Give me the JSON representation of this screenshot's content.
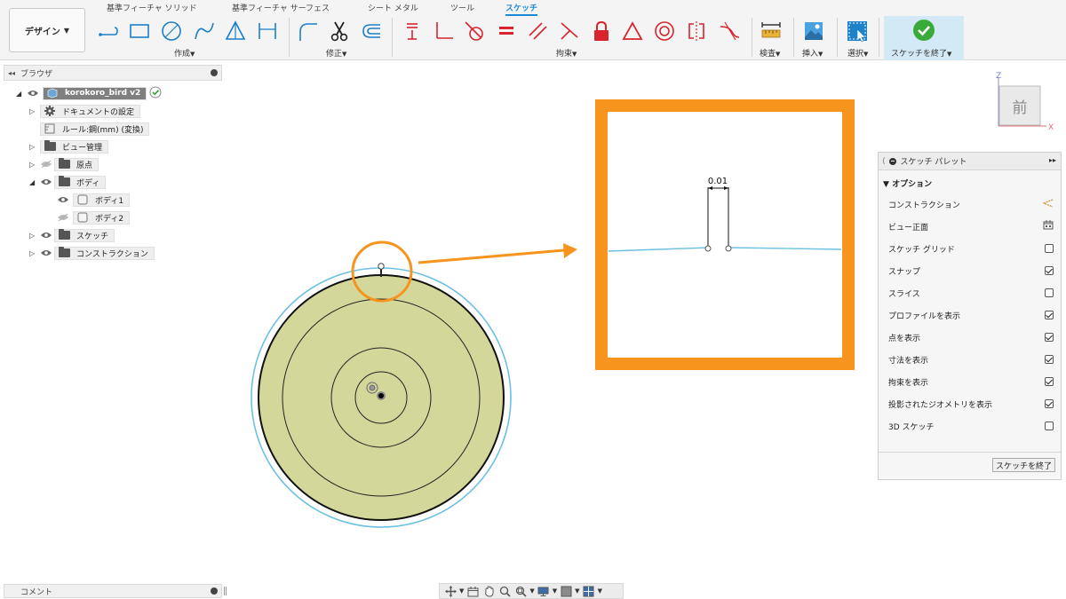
{
  "toolbar": {
    "workspace_button": "デザイン",
    "tabs": [
      {
        "label": "基準フィーチャ ソリッド",
        "active": false
      },
      {
        "label": "基準フィーチャ サーフェス",
        "active": false
      },
      {
        "label": "シート メタル",
        "active": false
      },
      {
        "label": "ツール",
        "active": false
      },
      {
        "label": "スケッチ",
        "active": true
      }
    ],
    "groups": {
      "create": "作成",
      "modify": "修正",
      "constraints": "拘束",
      "inspect": "検査",
      "insert": "挿入",
      "select": "選択",
      "finish_sketch": "スケッチを終了"
    },
    "accent_color": "#1a8ad8",
    "constraint_color": "#d8242c"
  },
  "browser": {
    "title": "ブラウザ",
    "items": [
      {
        "label": "korokoro_bird v2",
        "icon": "component-icon"
      },
      {
        "label": "ドキュメントの設定",
        "icon": "gear-icon"
      },
      {
        "label": "ルール:鋼(mm) (変換)",
        "icon": "ruler-icon"
      },
      {
        "label": "ビュー管理",
        "icon": "folder-icon"
      },
      {
        "label": "原点",
        "icon": "folder-icon"
      },
      {
        "label": "ボディ",
        "icon": "folder-icon"
      },
      {
        "label": "ボディ1",
        "icon": "body-icon"
      },
      {
        "label": "ボディ2",
        "icon": "body-icon"
      },
      {
        "label": "スケッチ",
        "icon": "folder-icon"
      },
      {
        "label": "コンストラクション",
        "icon": "folder-icon"
      }
    ]
  },
  "canvas": {
    "dimension_label": "0.01",
    "sketch_color": "#6cc0e0",
    "body_fill": "#d4d79a",
    "callout_color": "#f7941d"
  },
  "viewcube": {
    "face_label": "前",
    "axis_z": "Z",
    "axis_x": "X"
  },
  "palette": {
    "title": "スケッチ パレット",
    "section": "オプション",
    "options": [
      {
        "label": "コンストラクション",
        "kind": "icon",
        "icon": "construction-icon"
      },
      {
        "label": "ビュー正面",
        "kind": "icon",
        "icon": "look-at-icon"
      },
      {
        "label": "スケッチ グリッド",
        "kind": "check",
        "checked": false
      },
      {
        "label": "スナップ",
        "kind": "check",
        "checked": true
      },
      {
        "label": "スライス",
        "kind": "check",
        "checked": false
      },
      {
        "label": "プロファイルを表示",
        "kind": "check",
        "checked": true
      },
      {
        "label": "点を表示",
        "kind": "check",
        "checked": true
      },
      {
        "label": "寸法を表示",
        "kind": "check",
        "checked": true
      },
      {
        "label": "拘束を表示",
        "kind": "check",
        "checked": true
      },
      {
        "label": "投影されたジオメトリを表示",
        "kind": "check",
        "checked": true
      },
      {
        "label": "3D スケッチ",
        "kind": "check",
        "checked": false
      }
    ],
    "finish_button": "スケッチを終了"
  },
  "comments": {
    "title": "コメント"
  }
}
